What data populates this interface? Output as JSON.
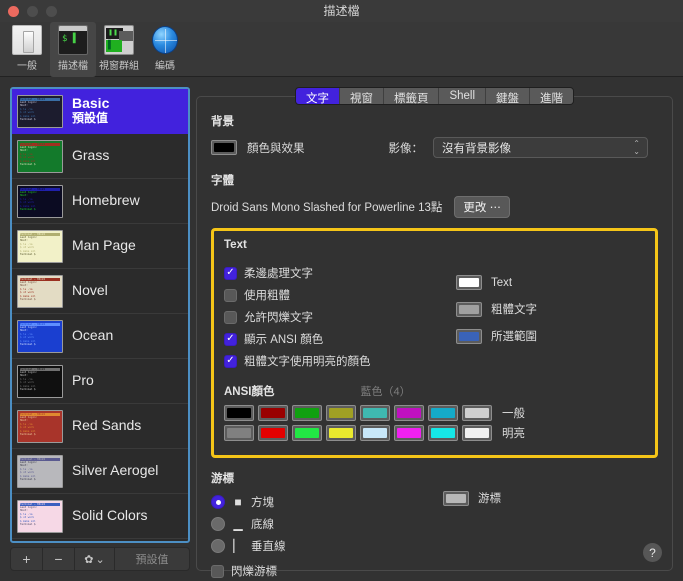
{
  "window": {
    "title": "描述檔",
    "traffic_lights": [
      "close",
      "minimize",
      "maximize"
    ]
  },
  "toolbar": {
    "items": [
      {
        "label": "一般",
        "icon": "general-icon",
        "active": false
      },
      {
        "label": "描述檔",
        "icon": "profiles-icon",
        "active": true
      },
      {
        "label": "視窗群組",
        "icon": "window-groups-icon",
        "active": false
      },
      {
        "label": "編碼",
        "icon": "encoding-globe-icon",
        "active": false
      }
    ]
  },
  "sidebar": {
    "profiles": [
      {
        "name": "Basic",
        "subtitle": "預設值",
        "selected": true,
        "bg": "#1c1c2e",
        "fg": "#d8d8e8",
        "accent": "#3a6ea5"
      },
      {
        "name": "Grass",
        "subtitle": "",
        "selected": false,
        "bg": "#137a2b",
        "fg": "#e8e8c0",
        "accent": "#a03020"
      },
      {
        "name": "Homebrew",
        "subtitle": "",
        "selected": false,
        "bg": "#0b0b22",
        "fg": "#22dd22",
        "accent": "#2020aa"
      },
      {
        "name": "Man Page",
        "subtitle": "",
        "selected": false,
        "bg": "#f2f1c8",
        "fg": "#4a4a20",
        "accent": "#b0ae70"
      },
      {
        "name": "Novel",
        "subtitle": "",
        "selected": false,
        "bg": "#e3dcc4",
        "fg": "#6a4030",
        "accent": "#9a3020"
      },
      {
        "name": "Ocean",
        "subtitle": "",
        "selected": false,
        "bg": "#1a3fd0",
        "fg": "#dde8ff",
        "accent": "#5f8fff"
      },
      {
        "name": "Pro",
        "subtitle": "",
        "selected": false,
        "bg": "#101010",
        "fg": "#d0d0d0",
        "accent": "#707070"
      },
      {
        "name": "Red Sands",
        "subtitle": "",
        "selected": false,
        "bg": "#a8342a",
        "fg": "#f2d8a8",
        "accent": "#e08a30"
      },
      {
        "name": "Silver Aerogel",
        "subtitle": "",
        "selected": false,
        "bg": "#b8b8bc",
        "fg": "#303040",
        "accent": "#5a5a90"
      },
      {
        "name": "Solid Colors",
        "subtitle": "",
        "selected": false,
        "bg": "#f6d8e6",
        "fg": "#404060",
        "accent": "#3a5fc0"
      }
    ],
    "thumb_lines": [
      "Terminal — 80x24",
      "Last login:",
      "Host:",
      "$ ls -la",
      "$ cd work",
      "$ make all",
      "Terminal $"
    ],
    "buttons": {
      "add": "+",
      "remove": "−",
      "gear": "✿",
      "gear_chevron": "⌄",
      "default_label": "預設值"
    }
  },
  "tabs": [
    {
      "label": "文字",
      "active": true
    },
    {
      "label": "視窗",
      "active": false
    },
    {
      "label": "標籤頁",
      "active": false
    },
    {
      "label": "Shell",
      "active": false
    },
    {
      "label": "鍵盤",
      "active": false
    },
    {
      "label": "進階",
      "active": false
    }
  ],
  "background": {
    "heading": "背景",
    "color_label": "顏色與效果",
    "color_value": "#000000",
    "image_label": "影像：",
    "image_value": "沒有背景影像"
  },
  "font": {
    "heading": "字體",
    "value": "Droid Sans Mono Slashed for Powerline 13點",
    "change_button": "更改 ⋯"
  },
  "text_section": {
    "heading": "Text",
    "highlight_color": "#f5c518",
    "checkboxes": [
      {
        "label": "柔邊處理文字",
        "checked": true
      },
      {
        "label": "使用粗體",
        "checked": false
      },
      {
        "label": "允許閃爍文字",
        "checked": false
      },
      {
        "label": "顯示 ANSI 顏色",
        "checked": true
      },
      {
        "label": "粗體文字使用明亮的顏色",
        "checked": true
      }
    ],
    "swatches": [
      {
        "label": "Text",
        "color": "#ffffff"
      },
      {
        "label": "粗體文字",
        "color": "#a0a0a0"
      },
      {
        "label": "所選範圍",
        "color": "#3a63b8"
      }
    ],
    "ansi": {
      "heading": "ANSI顏色",
      "selected_readout": "藍色（4）",
      "rows": [
        {
          "label": "一般",
          "colors": [
            "#000000",
            "#990000",
            "#10a010",
            "#a0a024",
            "#3fb8b0",
            "#c010c0",
            "#15aac8",
            "#cfcfcf"
          ]
        },
        {
          "label": "明亮",
          "colors": [
            "#808080",
            "#e40000",
            "#22e844",
            "#eaea2e",
            "#c8e8fa",
            "#f020f0",
            "#16e8e8",
            "#f0f0f0"
          ]
        }
      ]
    }
  },
  "cursor_section": {
    "heading": "游標",
    "options": [
      {
        "label": "方塊",
        "glyph": "■",
        "selected": true
      },
      {
        "label": "底線",
        "glyph": "▁",
        "selected": false
      },
      {
        "label": "垂直線",
        "glyph": "▏",
        "selected": false
      }
    ],
    "blink": {
      "label": "閃爍游標",
      "checked": false
    },
    "swatch": {
      "label": "游標",
      "color": "#b8b8b8"
    }
  },
  "help_button": "?"
}
